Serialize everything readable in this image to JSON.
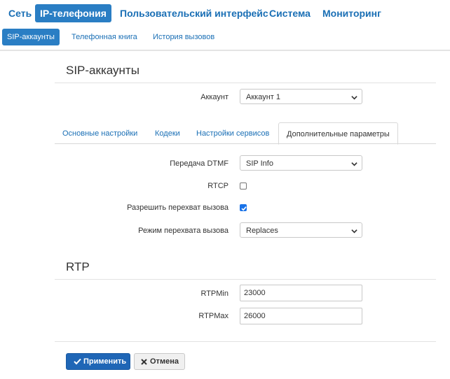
{
  "top_nav": [
    "Сеть",
    "IP-телефония",
    "Пользовательский интерфейс",
    "Система",
    "Мониторинг"
  ],
  "top_nav_active": "IP-телефония",
  "sub_nav": [
    "SIP-аккаунты",
    "Телефонная книга",
    "История вызовов"
  ],
  "sub_nav_active": "SIP-аккаунты",
  "section_sip": {
    "title": "SIP-аккаунты",
    "account_label": "Аккаунт",
    "account_value": "Аккаунт 1"
  },
  "tabs": [
    "Основные настройки",
    "Кодеки",
    "Настройки сервисов",
    "Дополнительные параметры"
  ],
  "tabs_active": "Дополнительные параметры",
  "advanced": {
    "dtmf_label": "Передача DTMF",
    "dtmf_value": "SIP Info",
    "rtcp_label": "RTCP",
    "rtcp_checked": false,
    "pickup_label": "Разрешить перехват вызова",
    "pickup_checked": true,
    "pickup_mode_label": "Режим перехвата вызова",
    "pickup_mode_value": "Replaces"
  },
  "section_rtp": {
    "title": "RTP",
    "rtpmin_label": "RTPMin",
    "rtpmin_value": "23000",
    "rtpmax_label": "RTPMax",
    "rtpmax_value": "26000"
  },
  "buttons": {
    "apply_label": "Применить",
    "cancel_label": "Отмена"
  },
  "colors": {
    "accent": "#2a7ec4",
    "link": "#1a6fb5",
    "apply_button": "#1f66b6"
  }
}
